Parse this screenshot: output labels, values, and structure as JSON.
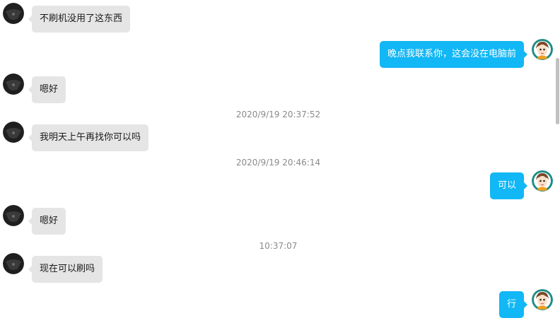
{
  "messages": [
    {
      "type": "text",
      "side": "in",
      "text": "不刷机没用了这东西"
    },
    {
      "type": "text",
      "side": "out",
      "text": "晚点我联系你，这会没在电脑前"
    },
    {
      "type": "text",
      "side": "in",
      "text": "嗯好"
    },
    {
      "type": "time",
      "text": "2020/9/19 20:37:52"
    },
    {
      "type": "text",
      "side": "in",
      "text": "我明天上午再找你可以吗"
    },
    {
      "type": "time",
      "text": "2020/9/19 20:46:14"
    },
    {
      "type": "text",
      "side": "out",
      "text": "可以"
    },
    {
      "type": "text",
      "side": "in",
      "text": "嗯好"
    },
    {
      "type": "time",
      "text": "10:37:07"
    },
    {
      "type": "text",
      "side": "in",
      "text": "现在可以刷吗"
    },
    {
      "type": "text",
      "side": "out",
      "text": "行"
    }
  ],
  "colors": {
    "incoming_bubble": "#e5e5e5",
    "outgoing_bubble": "#12b7f5",
    "timestamp_text": "#8a8a8a"
  },
  "icons": {
    "incoming_avatar": "dark-avatar-icon",
    "outgoing_avatar": "cartoon-person-avatar-icon"
  }
}
